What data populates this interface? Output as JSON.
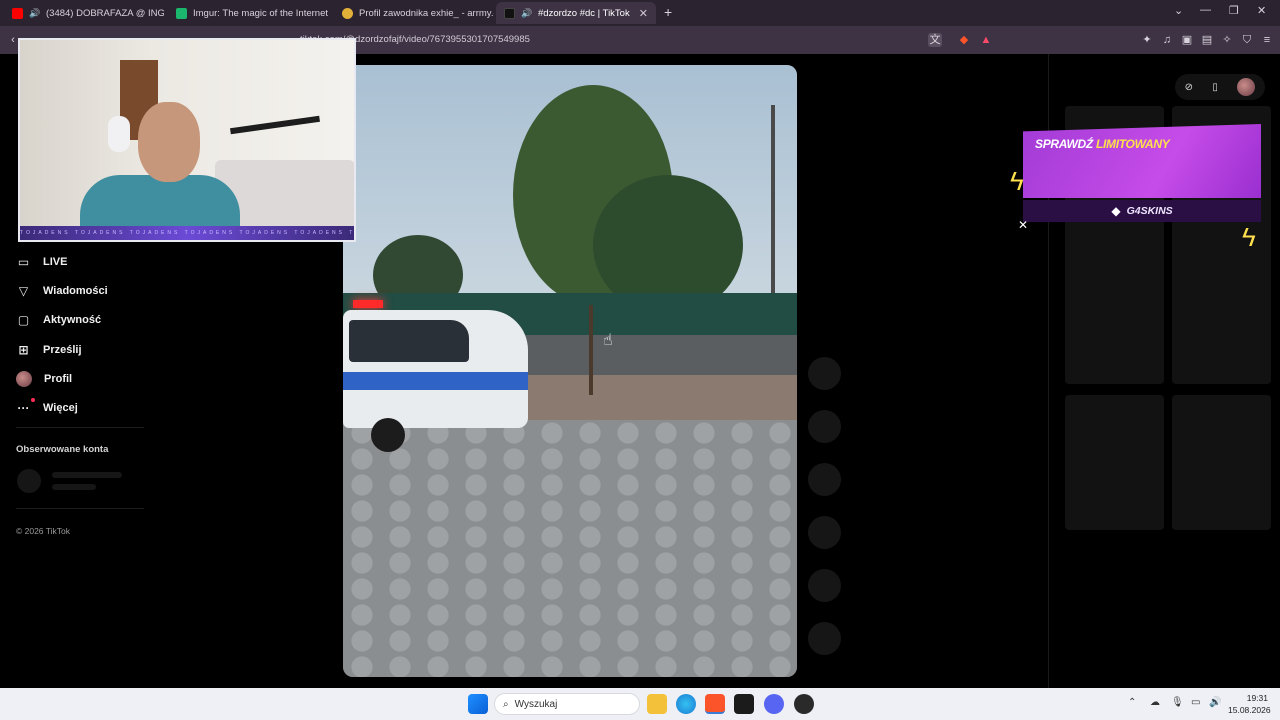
{
  "browser": {
    "tabs": [
      {
        "title": "(3484) DOBRAFAZA @ ING SILES",
        "active": false
      },
      {
        "title": "Imgur: The magic of the Internet",
        "active": false
      },
      {
        "title": "Profil zawodnika exhie_ - arrmy.gg",
        "active": false
      },
      {
        "title": "#dzordzo #dc | TikTok",
        "active": true
      }
    ],
    "address": "tiktok.com/@dzordzofajf/video/7673955301707549985"
  },
  "sidebar": {
    "items": [
      {
        "label": "LIVE",
        "icon": "live-icon"
      },
      {
        "label": "Wiadomości",
        "icon": "send-icon"
      },
      {
        "label": "Aktywność",
        "icon": "activity-icon"
      },
      {
        "label": "Prześlij",
        "icon": "upload-icon"
      },
      {
        "label": "Profil",
        "icon": "avatar"
      },
      {
        "label": "Więcej",
        "icon": "more-icon"
      }
    ],
    "following_title": "Obserwowane konta",
    "copyright": "© 2026 TikTok"
  },
  "ad": {
    "title_main": "SPRAWDŹ",
    "title_highlight": "LIMITOWANY",
    "brand": "G4SKINS"
  },
  "webcam": {
    "strip_text": "TOJADENS TOJADENS TOJADENS TOJADENS TOJADENS TOJADENS TOJADENS TOJADENS"
  },
  "taskbar": {
    "search_placeholder": "Wyszukaj",
    "time": "19:31",
    "date": "15.08.2026"
  },
  "colors": {
    "tab_bar": "#2b2330",
    "toolbar": "#3d3344",
    "accent": "#fe2c55",
    "ad_purple": "#c64ce8"
  }
}
